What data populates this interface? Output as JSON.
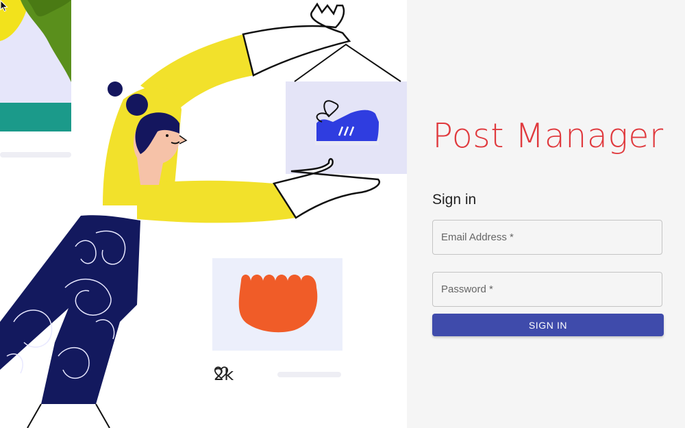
{
  "brand": {
    "title": "Post Manager",
    "color": "#e03a3e"
  },
  "login": {
    "heading": "Sign in",
    "email_placeholder": "Email Address *",
    "password_placeholder": "Password *",
    "submit_label": "SIGN IN",
    "button_color": "#3f4bab"
  },
  "illustration": {
    "likes_icon": "heart-outline-icon",
    "likes_count": "2k"
  }
}
